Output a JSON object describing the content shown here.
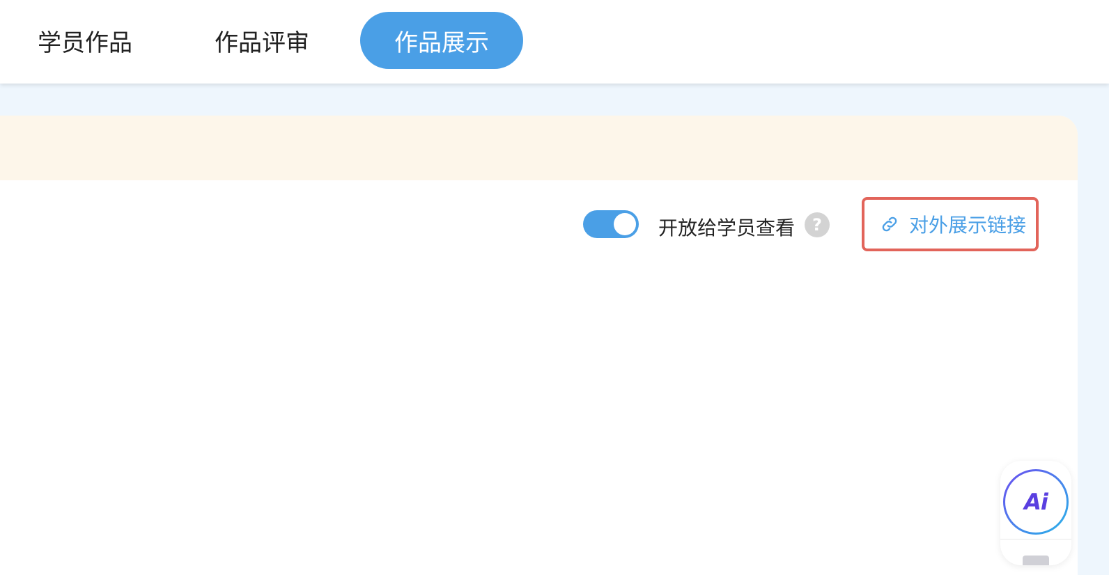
{
  "tabs": [
    {
      "label": "学员作品",
      "active": false
    },
    {
      "label": "作品评审",
      "active": false
    },
    {
      "label": "作品展示",
      "active": true
    }
  ],
  "toolbar": {
    "toggle_label": "开放给学员查看",
    "toggle_on": true,
    "help_symbol": "?",
    "link_button_label": "对外展示链接",
    "link_icon": "link-icon"
  },
  "float_panel": {
    "ai_label": "Ai"
  },
  "colors": {
    "accent": "#4a9fe6",
    "notice_bg": "#fdf6ea",
    "highlight_border": "#e2645a",
    "page_bg": "#eef6fd"
  }
}
